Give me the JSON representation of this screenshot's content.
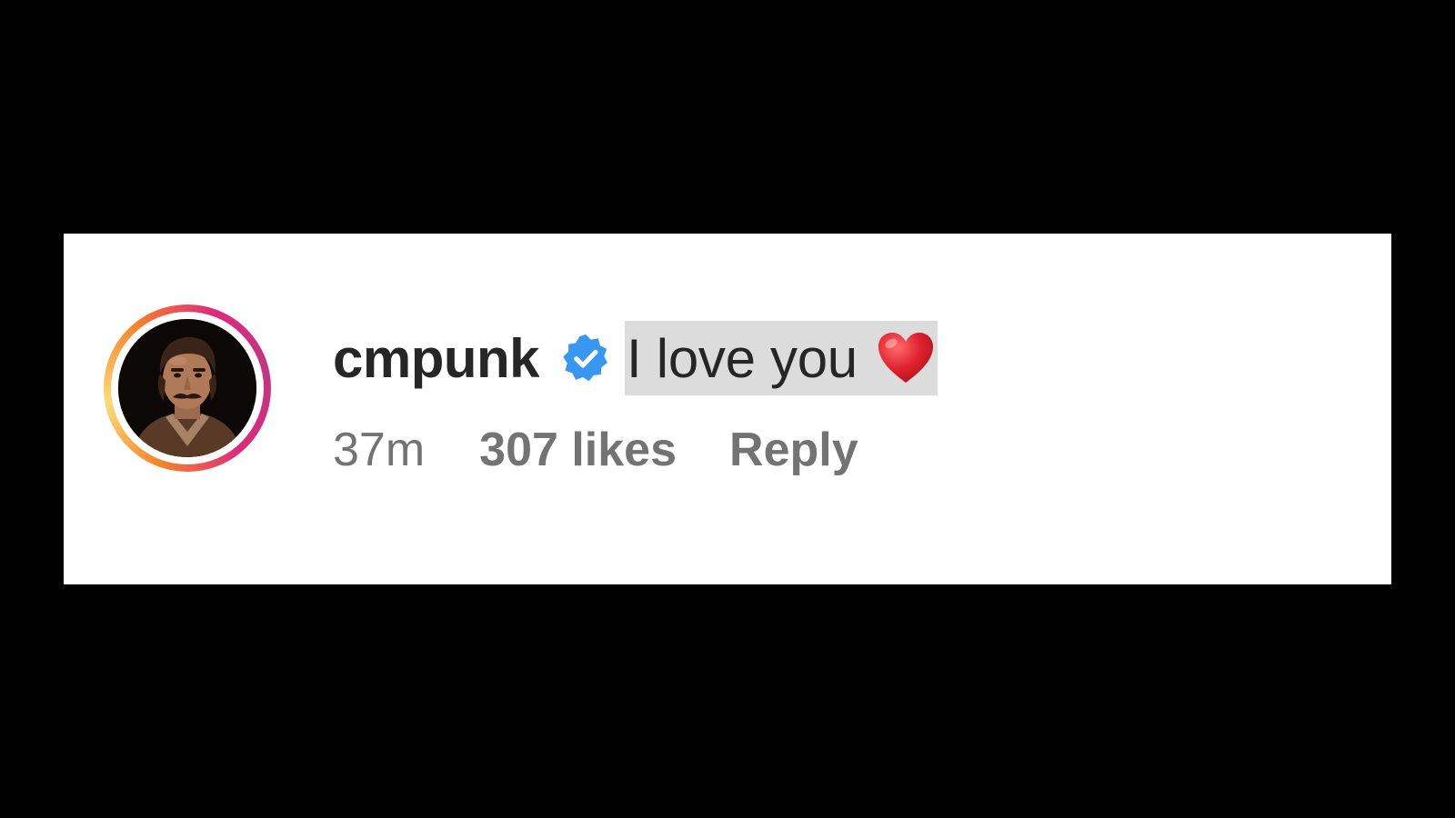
{
  "comment": {
    "username": "cmpunk",
    "verified_icon": "verified-badge-icon",
    "text": "I love you",
    "emoji_icon": "red-heart-icon",
    "timestamp": "37m",
    "likes": "307 likes",
    "reply_label": "Reply"
  },
  "colors": {
    "page_background": "#000000",
    "card_background": "#ffffff",
    "username_text": "#262626",
    "meta_text": "#737373",
    "verified_blue": "#3897f0",
    "text_highlight": "#dcdcdc",
    "heart_red": "#e0242f",
    "story_ring": [
      "#f58529",
      "#feda77",
      "#dd2a7b",
      "#c13584"
    ]
  }
}
